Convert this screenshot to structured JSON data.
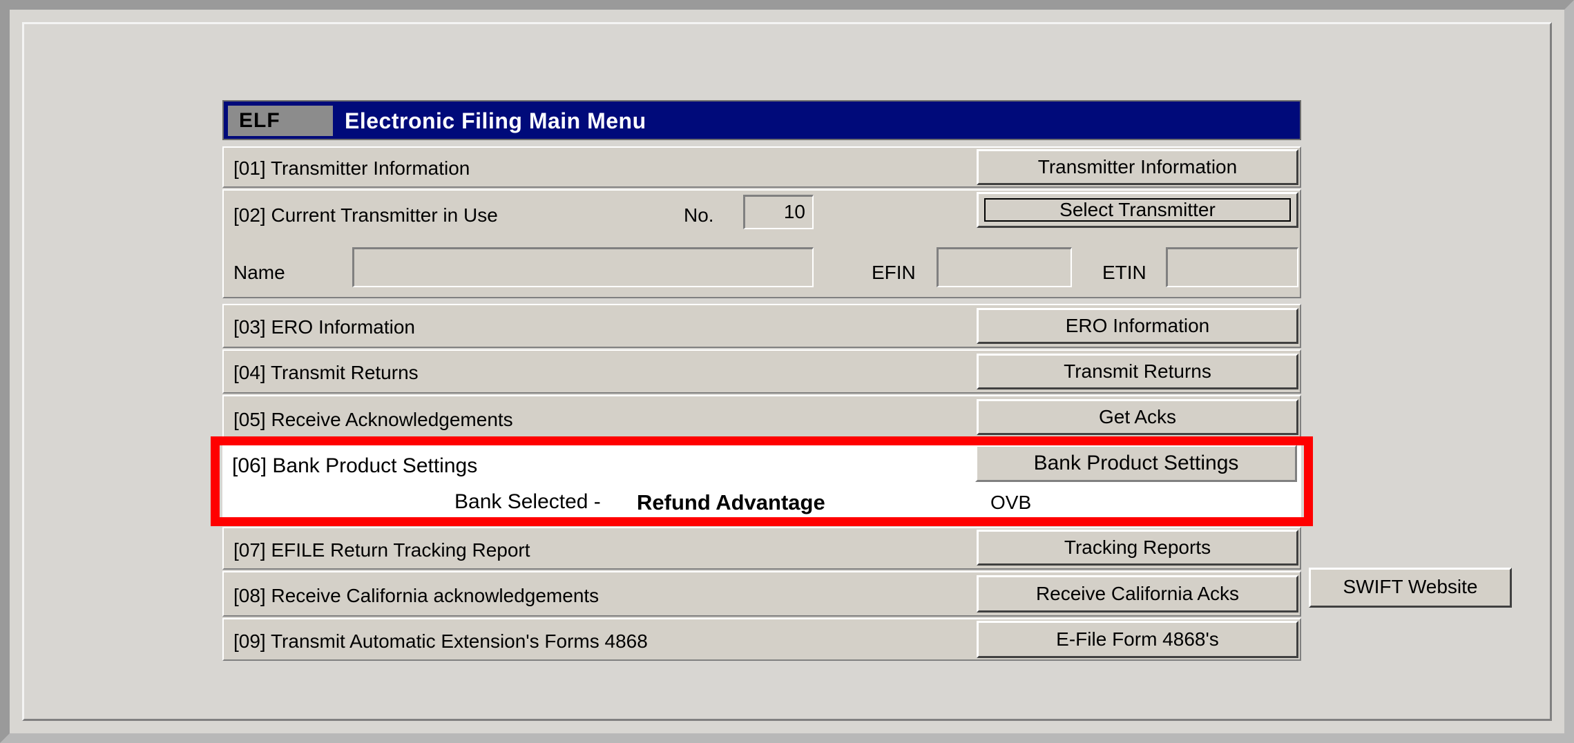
{
  "menu": {
    "code": "ELF",
    "title": "Electronic Filing Main Menu"
  },
  "rows": {
    "r01": {
      "label": "[01]  Transmitter Information",
      "button": "Transmitter Information"
    },
    "r02": {
      "label": "[02]  Current Transmitter in Use",
      "no_label": "No.",
      "no_value": "10",
      "button": "Select Transmitter",
      "name_label": "Name",
      "name_value": "",
      "efin_label": "EFIN",
      "efin_value": "",
      "etin_label": "ETIN",
      "etin_value": ""
    },
    "r03": {
      "label": "[03]  ERO Information",
      "button": "ERO Information"
    },
    "r04": {
      "label": "[04]  Transmit Returns",
      "button": "Transmit Returns"
    },
    "r05": {
      "label": "[05]  Receive Acknowledgements",
      "button": "Get Acks"
    },
    "r06": {
      "label": "[06]  Bank Product Settings",
      "button": "Bank Product Settings",
      "bank_selected_label": "Bank Selected -",
      "bank_selected_value": "Refund Advantage",
      "code_value": "OVB"
    },
    "r07": {
      "label": "[07]  EFILE Return Tracking Report",
      "button": "Tracking Reports"
    },
    "r08": {
      "label": "[08]  Receive California acknowledgements",
      "button": "Receive California Acks"
    },
    "r09": {
      "label": "[09]  Transmit Automatic Extension's Forms 4868",
      "button": "E-File Form 4868's"
    }
  },
  "swift_button": "SWIFT Website",
  "colors": {
    "titlebar": "#000a7a",
    "highlight_border": "#ff0000",
    "window_bg": "#d4d0c8"
  }
}
